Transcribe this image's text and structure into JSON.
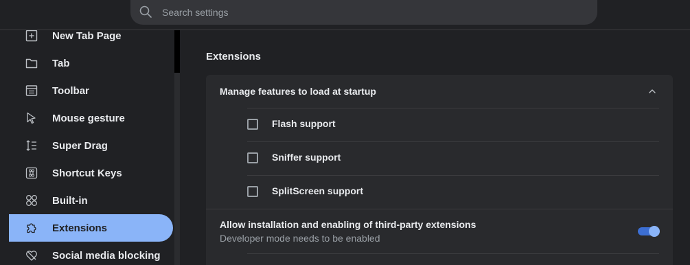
{
  "search": {
    "placeholder": "Search settings",
    "icon": "search-icon"
  },
  "sidebar": {
    "items": [
      {
        "label": "New Tab Page",
        "icon": "new-tab-icon"
      },
      {
        "label": "Tab",
        "icon": "tab-folder-icon"
      },
      {
        "label": "Toolbar",
        "icon": "toolbar-icon"
      },
      {
        "label": "Mouse gesture",
        "icon": "cursor-icon"
      },
      {
        "label": "Super Drag",
        "icon": "super-drag-icon"
      },
      {
        "label": "Shortcut Keys",
        "icon": "command-key-icon"
      },
      {
        "label": "Built-in",
        "icon": "built-in-icon"
      },
      {
        "label": "Extensions",
        "icon": "puzzle-icon",
        "active": true
      },
      {
        "label": "Social media blocking",
        "icon": "heart-slash-icon"
      }
    ]
  },
  "main": {
    "section_title": "Extensions",
    "startup": {
      "title": "Manage features to load at startup",
      "expanded": true,
      "options": [
        {
          "label": "Flash support",
          "checked": false
        },
        {
          "label": "Sniffer support",
          "checked": false
        },
        {
          "label": "SplitScreen support",
          "checked": false
        }
      ]
    },
    "third_party": {
      "title": "Allow installation and enabling of third-party extensions",
      "subtitle": "Developer mode needs to be enabled",
      "enabled": true
    }
  },
  "colors": {
    "accent": "#8ab4f8",
    "background": "#202124",
    "card": "#292a2d"
  }
}
